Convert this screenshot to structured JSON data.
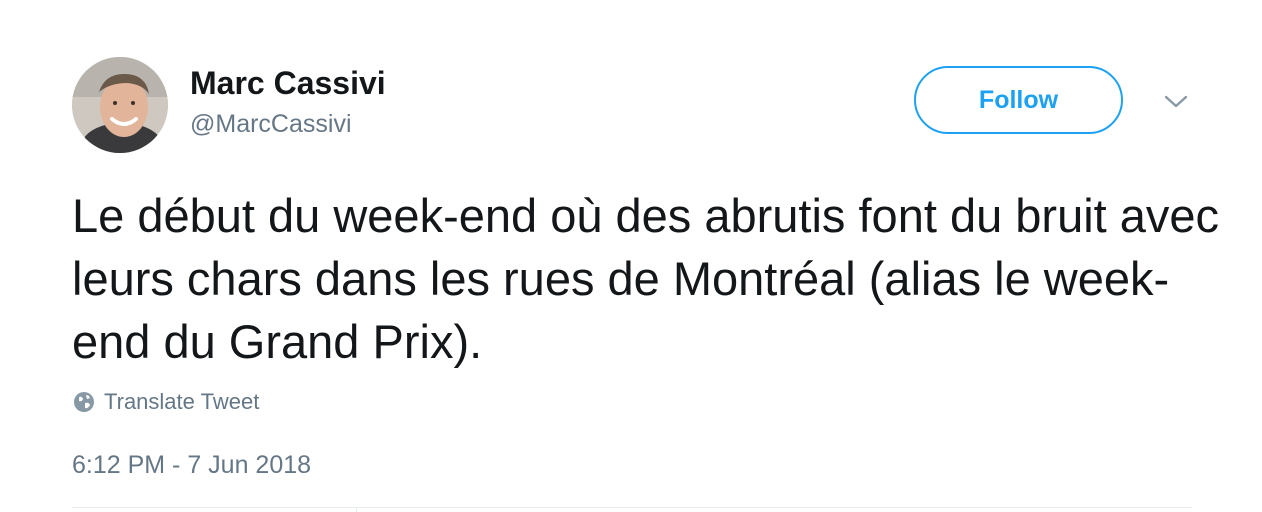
{
  "author": {
    "name": "Marc Cassivi",
    "handle": "@MarcCassivi"
  },
  "actions": {
    "follow_label": "Follow",
    "menu_icon": "chevron-down-icon"
  },
  "tweet": {
    "text": "Le début du week-end où des abrutis font du bruit avec leurs chars dans les rues de Montréal (alias le week-end du Grand Prix).",
    "translate_label": "Translate Tweet",
    "translate_icon": "globe-icon",
    "timestamp": "6:12 PM - 7 Jun 2018"
  },
  "colors": {
    "accent": "#1da1f2",
    "text_primary": "#14171a",
    "text_secondary": "#657786",
    "divider": "#e6ecf0"
  }
}
